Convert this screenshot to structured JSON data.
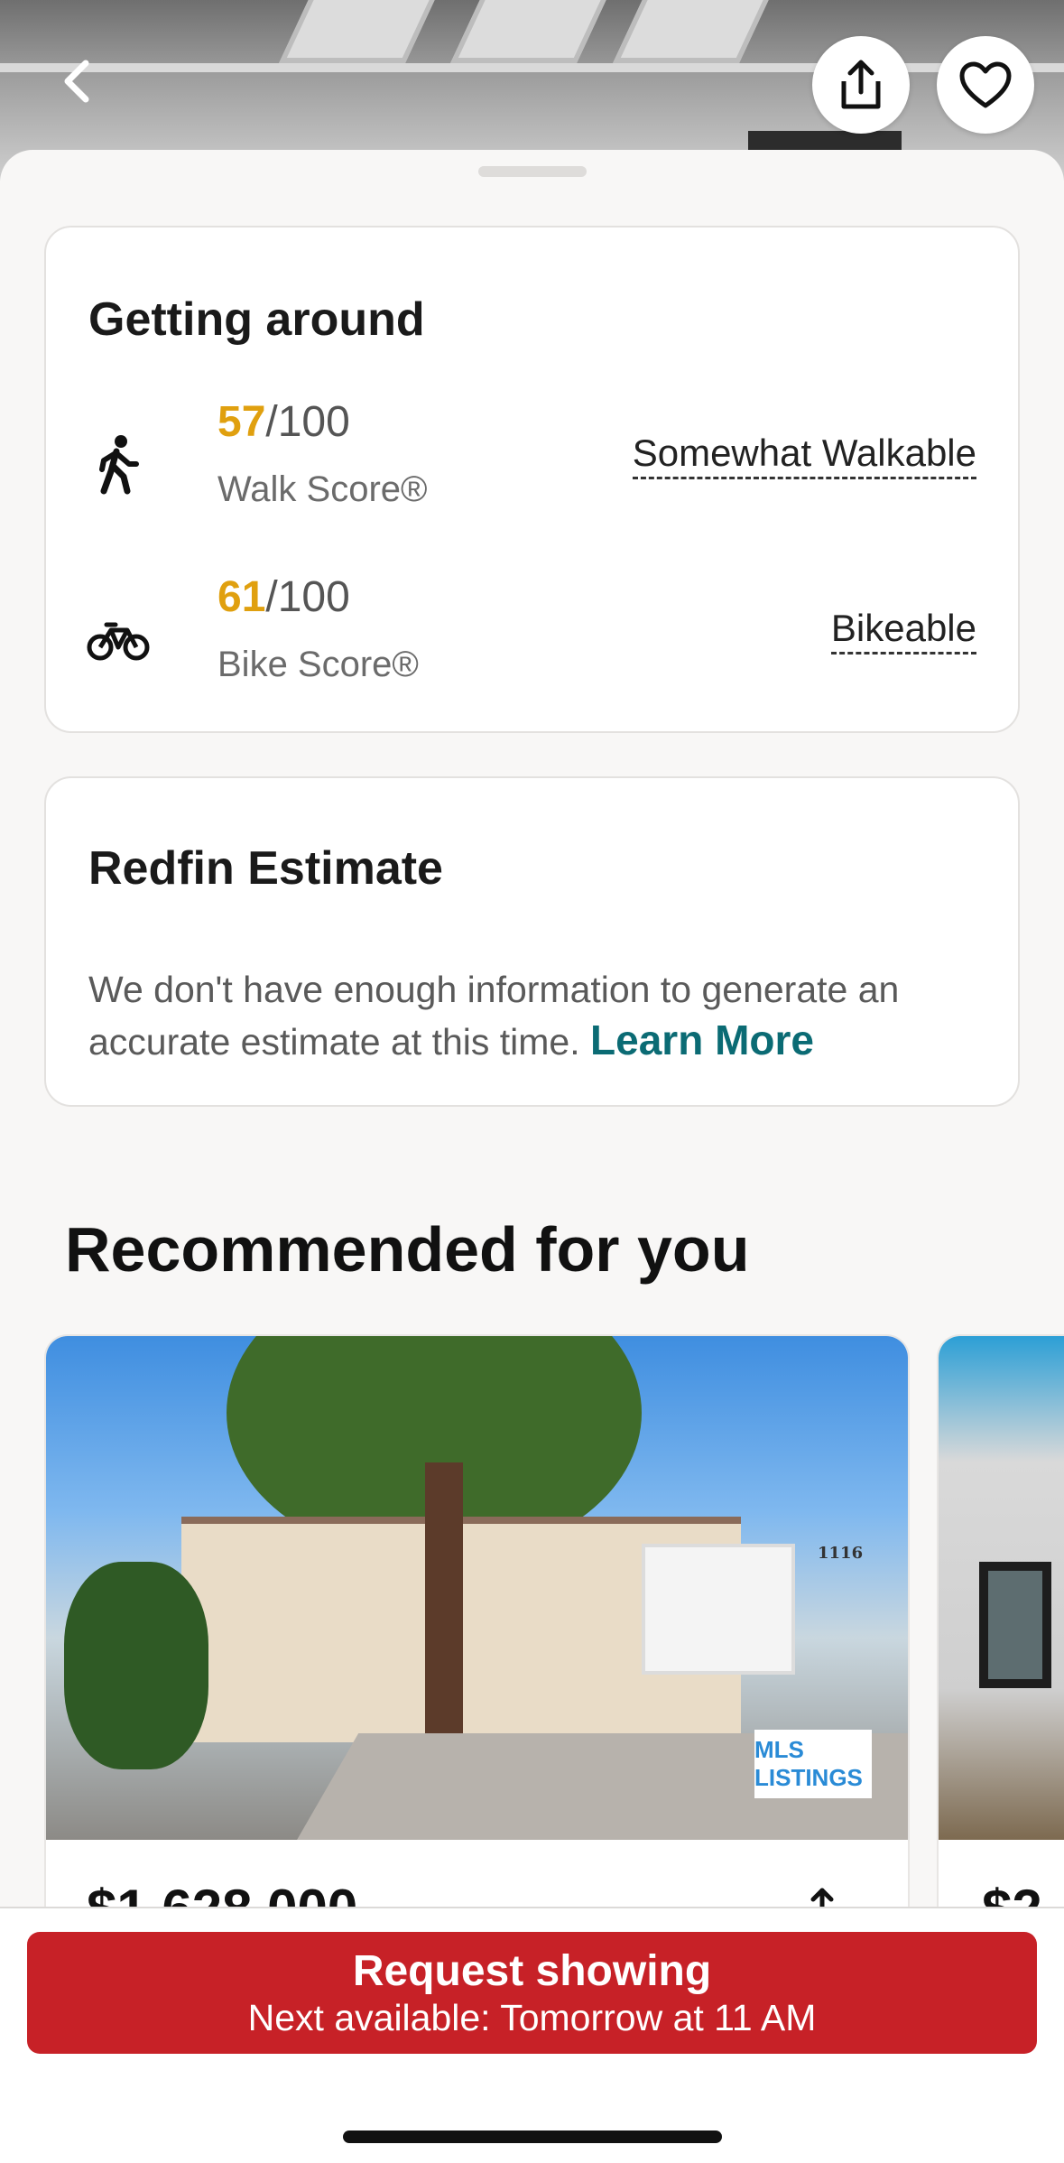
{
  "getting_around": {
    "title": "Getting around",
    "walk": {
      "score": "57",
      "out_of": "/100",
      "label": "Walk Score®",
      "rating": "Somewhat Walkable"
    },
    "bike": {
      "score": "61",
      "out_of": "/100",
      "label": "Bike Score®",
      "rating": "Bikeable"
    }
  },
  "estimate": {
    "title": "Redfin Estimate",
    "text": "We don't have enough information to generate an accurate estimate at this time.",
    "link": "Learn More"
  },
  "recommended": {
    "title": "Recommended for you",
    "listings": [
      {
        "price": "$1,628,000",
        "house_number": "1116",
        "logo_text": "MLS LISTINGS"
      },
      {
        "price": "$2"
      }
    ]
  },
  "cta": {
    "title": "Request showing",
    "subtitle": "Next available: Tomorrow at 11 AM"
  },
  "colors": {
    "score_accent": "#e0a00f",
    "link_teal": "#0b6b74",
    "cta_red": "#c72127"
  },
  "icons": [
    "chevron-left-icon",
    "share-icon",
    "heart-icon",
    "walk-icon",
    "bike-icon"
  ]
}
